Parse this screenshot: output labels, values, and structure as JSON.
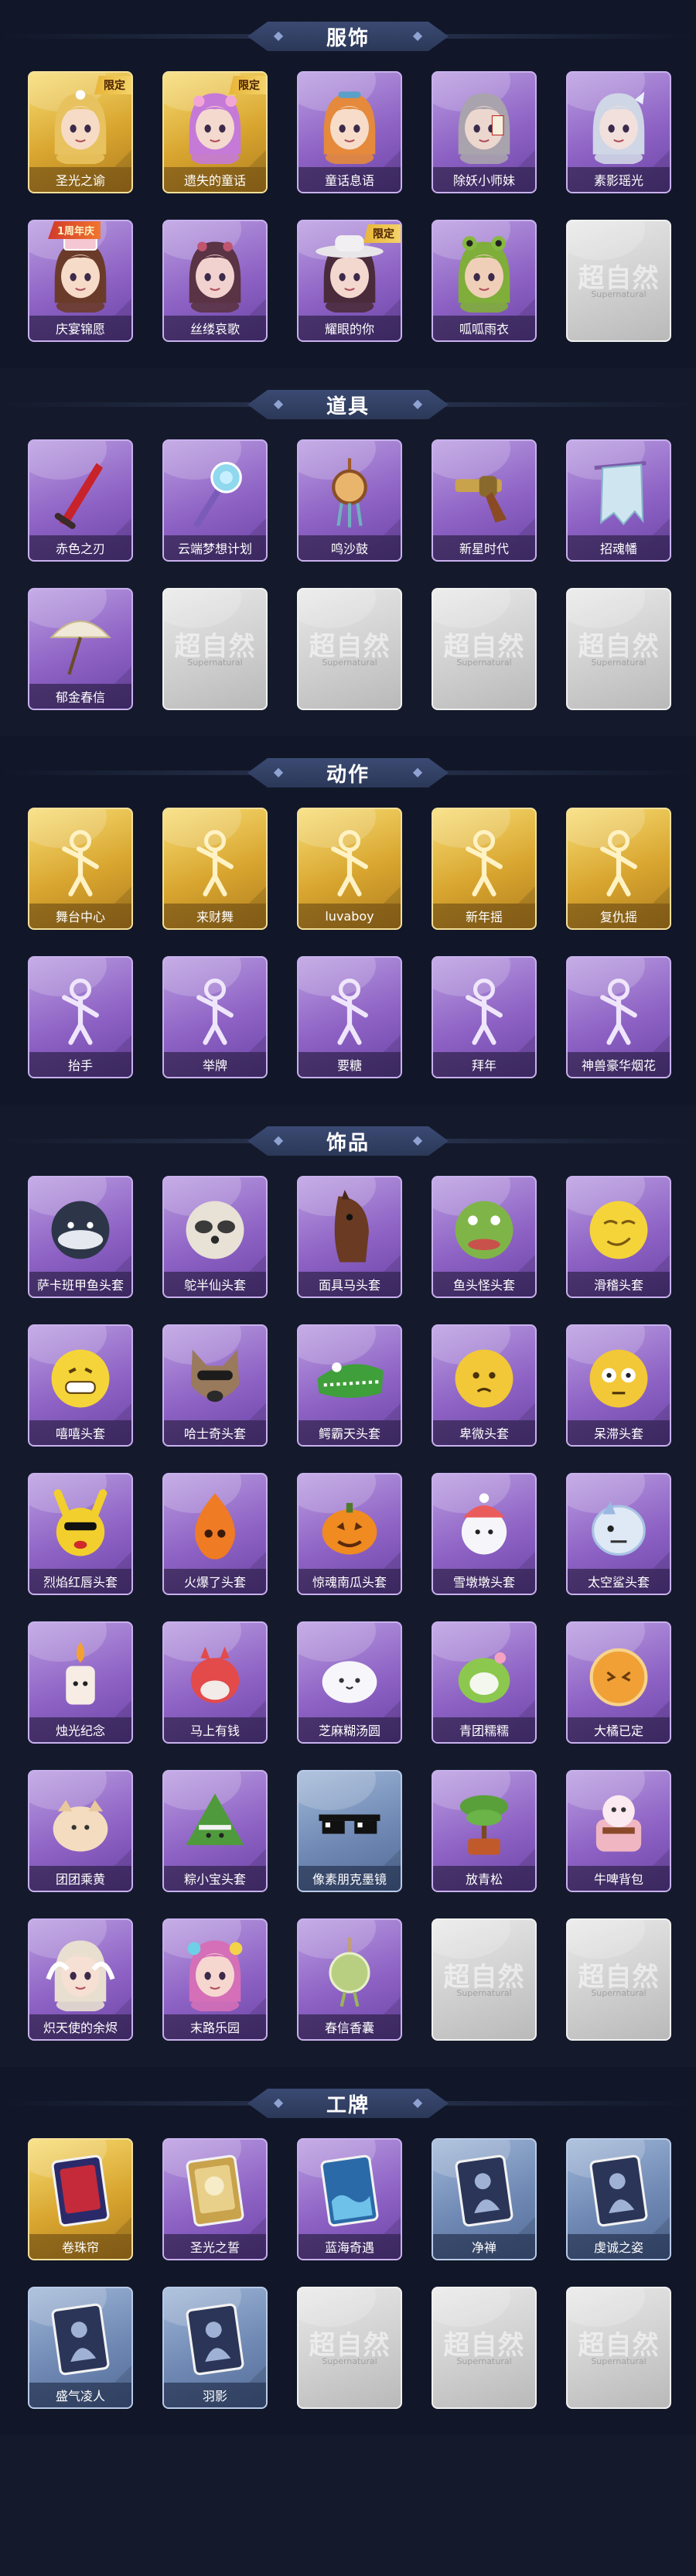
{
  "colors": {
    "background": "#141a2b",
    "header_pill": "#34426a",
    "card_purple": "#9a73cf",
    "card_gold": "#e2b23f",
    "card_blue": "#7690bb",
    "card_empty": "#d2d2d2",
    "badge_limited": "#f0c34a"
  },
  "empty_card": {
    "watermark": "超自然",
    "watermark_sub": "Supernatural"
  },
  "sections": [
    {
      "title": "服饰",
      "items": [
        {
          "label": "圣光之谕",
          "tier": "gold",
          "icon": "character-blonde-icon",
          "badge": "限定"
        },
        {
          "label": "遗失的童话",
          "tier": "gold",
          "icon": "character-pink-hair-icon",
          "badge": "限定"
        },
        {
          "label": "童话息语",
          "tier": "purple",
          "icon": "character-orange-hair-icon",
          "badge": ""
        },
        {
          "label": "除妖小师妹",
          "tier": "purple",
          "icon": "character-grey-hair-icon",
          "badge": ""
        },
        {
          "label": "素影瑶光",
          "tier": "purple",
          "icon": "character-silver-hair-icon",
          "badge": ""
        },
        {
          "label": "庆宴锦愿",
          "tier": "purple",
          "icon": "character-cake-hat-icon",
          "badge": "1周年庆"
        },
        {
          "label": "丝缕哀歌",
          "tier": "purple",
          "icon": "character-dark-hair-icon",
          "badge": ""
        },
        {
          "label": "耀眼的你",
          "tier": "purple",
          "icon": "character-cowboy-hat-icon",
          "badge": "限定"
        },
        {
          "label": "呱呱雨衣",
          "tier": "purple",
          "icon": "character-frog-hood-icon",
          "badge": ""
        },
        {
          "label": "",
          "tier": "empty",
          "icon": "empty-placeholder-icon",
          "badge": ""
        }
      ]
    },
    {
      "title": "道具",
      "items": [
        {
          "label": "赤色之刃",
          "tier": "purple",
          "icon": "red-blade-icon",
          "badge": ""
        },
        {
          "label": "云端梦想计划",
          "tier": "purple",
          "icon": "crystal-mace-icon",
          "badge": ""
        },
        {
          "label": "鸣沙鼓",
          "tier": "purple",
          "icon": "sand-drum-icon",
          "badge": ""
        },
        {
          "label": "新星时代",
          "tier": "purple",
          "icon": "revolver-icon",
          "badge": ""
        },
        {
          "label": "招魂幡",
          "tier": "purple",
          "icon": "spirit-banner-icon",
          "badge": ""
        },
        {
          "label": "郁金春信",
          "tier": "purple",
          "icon": "paper-umbrella-icon",
          "badge": ""
        },
        {
          "label": "",
          "tier": "empty",
          "icon": "empty-placeholder-icon",
          "badge": ""
        },
        {
          "label": "",
          "tier": "empty",
          "icon": "empty-placeholder-icon",
          "badge": ""
        },
        {
          "label": "",
          "tier": "empty",
          "icon": "empty-placeholder-icon",
          "badge": ""
        },
        {
          "label": "",
          "tier": "empty",
          "icon": "empty-placeholder-icon",
          "badge": ""
        }
      ]
    },
    {
      "title": "动作",
      "items": [
        {
          "label": "舞台中心",
          "tier": "gold",
          "icon": "pose-stage-icon",
          "badge": ""
        },
        {
          "label": "来财舞",
          "tier": "gold",
          "icon": "pose-fortune-dance-icon",
          "badge": ""
        },
        {
          "label": "luvaboy",
          "tier": "gold",
          "icon": "pose-luvaboy-icon",
          "badge": ""
        },
        {
          "label": "新年摇",
          "tier": "gold",
          "icon": "pose-newyear-shake-icon",
          "badge": ""
        },
        {
          "label": "复仇摇",
          "tier": "gold",
          "icon": "pose-revenge-shake-icon",
          "badge": ""
        },
        {
          "label": "抬手",
          "tier": "purple",
          "icon": "pose-raise-hand-icon",
          "badge": ""
        },
        {
          "label": "举牌",
          "tier": "purple",
          "icon": "pose-hold-sign-icon",
          "badge": ""
        },
        {
          "label": "要糖",
          "tier": "purple",
          "icon": "pose-ask-candy-icon",
          "badge": ""
        },
        {
          "label": "拜年",
          "tier": "purple",
          "icon": "pose-new-year-greeting-icon",
          "badge": ""
        },
        {
          "label": "神兽豪华烟花",
          "tier": "purple",
          "icon": "pose-fireworks-icon",
          "badge": ""
        }
      ]
    },
    {
      "title": "饰品",
      "items": [
        {
          "label": "萨卡班甲鱼头套",
          "tier": "purple",
          "icon": "fish-head-icon",
          "badge": ""
        },
        {
          "label": "鸵半仙头套",
          "tier": "purple",
          "icon": "raccoon-head-icon",
          "badge": ""
        },
        {
          "label": "面具马头套",
          "tier": "purple",
          "icon": "horse-head-icon",
          "badge": ""
        },
        {
          "label": "鱼头怪头套",
          "tier": "purple",
          "icon": "green-fish-head-icon",
          "badge": ""
        },
        {
          "label": "滑稽头套",
          "tier": "purple",
          "icon": "funny-face-icon",
          "badge": ""
        },
        {
          "label": "嘻嘻头套",
          "tier": "purple",
          "icon": "grin-face-icon",
          "badge": ""
        },
        {
          "label": "哈士奇头套",
          "tier": "purple",
          "icon": "husky-head-icon",
          "badge": ""
        },
        {
          "label": "鳄霸天头套",
          "tier": "purple",
          "icon": "crocodile-head-icon",
          "badge": ""
        },
        {
          "label": "卑微头套",
          "tier": "purple",
          "icon": "humble-face-icon",
          "badge": ""
        },
        {
          "label": "呆滞头套",
          "tier": "purple",
          "icon": "dazed-face-icon",
          "badge": ""
        },
        {
          "label": "烈焰红唇头套",
          "tier": "purple",
          "icon": "yellow-mouse-head-icon",
          "badge": ""
        },
        {
          "label": "火爆了头套",
          "tier": "purple",
          "icon": "fire-spirit-icon",
          "badge": ""
        },
        {
          "label": "惊魂南瓜头套",
          "tier": "purple",
          "icon": "pumpkin-head-icon",
          "badge": ""
        },
        {
          "label": "雪墩墩头套",
          "tier": "purple",
          "icon": "snow-doll-head-icon",
          "badge": ""
        },
        {
          "label": "太空鲨头套",
          "tier": "purple",
          "icon": "space-shark-head-icon",
          "badge": ""
        },
        {
          "label": "烛光纪念",
          "tier": "purple",
          "icon": "candle-icon",
          "badge": ""
        },
        {
          "label": "马上有钱",
          "tier": "purple",
          "icon": "lucky-horse-icon",
          "badge": ""
        },
        {
          "label": "芝麻糊汤圆",
          "tier": "purple",
          "icon": "dumpling-icon",
          "badge": ""
        },
        {
          "label": "青团糯糯",
          "tier": "purple",
          "icon": "green-rice-ball-icon",
          "badge": ""
        },
        {
          "label": "大橘已定",
          "tier": "purple",
          "icon": "orange-slice-icon",
          "badge": ""
        },
        {
          "label": "团团乘黄",
          "tier": "purple",
          "icon": "golden-beast-icon",
          "badge": ""
        },
        {
          "label": "粽小宝头套",
          "tier": "purple",
          "icon": "zongzi-head-icon",
          "badge": ""
        },
        {
          "label": "像素朋克墨镜",
          "tier": "blue",
          "icon": "pixel-sunglasses-icon",
          "badge": ""
        },
        {
          "label": "放青松",
          "tier": "purple",
          "icon": "bonsai-pine-icon",
          "badge": ""
        },
        {
          "label": "牛啤背包",
          "tier": "purple",
          "icon": "cow-backpack-icon",
          "badge": ""
        },
        {
          "label": "炽天使的余烬",
          "tier": "purple",
          "icon": "angel-doll-icon",
          "badge": ""
        },
        {
          "label": "末路乐园",
          "tier": "purple",
          "icon": "clown-doll-icon",
          "badge": ""
        },
        {
          "label": "春信香囊",
          "tier": "purple",
          "icon": "spring-sachet-icon",
          "badge": ""
        },
        {
          "label": "",
          "tier": "empty",
          "icon": "empty-placeholder-icon",
          "badge": ""
        },
        {
          "label": "",
          "tier": "empty",
          "icon": "empty-placeholder-icon",
          "badge": ""
        }
      ]
    },
    {
      "title": "工牌",
      "items": [
        {
          "label": "卷珠帘",
          "tier": "gold",
          "icon": "badge-card-red-icon",
          "badge": ""
        },
        {
          "label": "圣光之誓",
          "tier": "purple",
          "icon": "badge-card-gold-icon",
          "badge": ""
        },
        {
          "label": "蓝海奇遇",
          "tier": "purple",
          "icon": "badge-card-ocean-icon",
          "badge": ""
        },
        {
          "label": "净禅",
          "tier": "blue",
          "icon": "badge-card-silhouette-icon",
          "badge": ""
        },
        {
          "label": "虔诚之姿",
          "tier": "blue",
          "icon": "badge-card-silhouette-icon",
          "badge": ""
        },
        {
          "label": "盛气凌人",
          "tier": "blue",
          "icon": "badge-card-silhouette-icon",
          "badge": ""
        },
        {
          "label": "羽影",
          "tier": "blue",
          "icon": "badge-card-silhouette-icon",
          "badge": ""
        },
        {
          "label": "",
          "tier": "empty",
          "icon": "empty-placeholder-icon",
          "badge": ""
        },
        {
          "label": "",
          "tier": "empty",
          "icon": "empty-placeholder-icon",
          "badge": ""
        },
        {
          "label": "",
          "tier": "empty",
          "icon": "empty-placeholder-icon",
          "badge": ""
        }
      ]
    }
  ]
}
